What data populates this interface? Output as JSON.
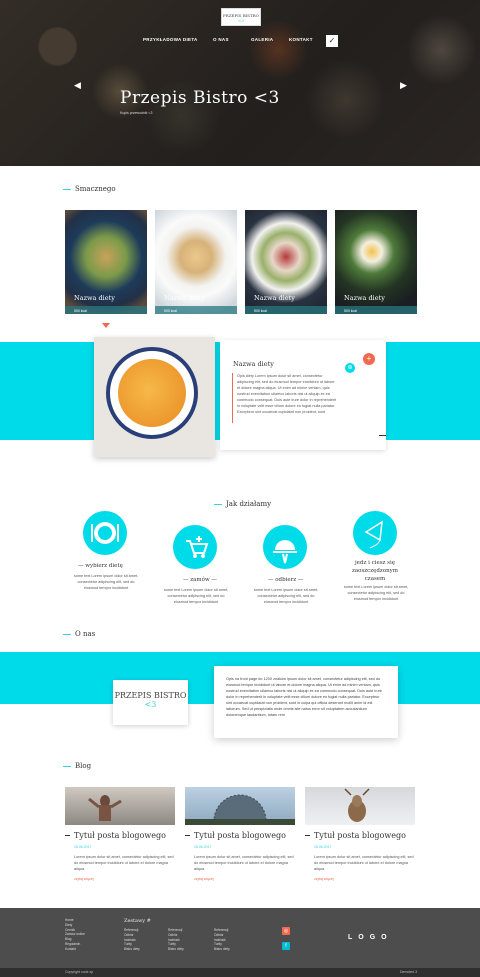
{
  "header": {
    "logo_line1": "PRZEPIS BISTRO",
    "logo_line2": "<3",
    "nav": [
      "PRZYKŁADOWA DIETA",
      "O NAS",
      "GALERIA",
      "KONTAKT"
    ],
    "title": "Przepis Bistro <3",
    "subtitle": "Kupis przewodnik <3"
  },
  "diets": {
    "heading": "Smacznego",
    "cards": [
      {
        "title": "Nazwa diety",
        "kcal": "500 kcal"
      },
      {
        "title": "Nazwa diety",
        "kcal": "500 kcal"
      },
      {
        "title": "Nazwa diety",
        "kcal": "500 kcal"
      },
      {
        "title": "Nazwa diety",
        "kcal": "500 kcal"
      }
    ]
  },
  "featured": {
    "title": "Nazwa diety",
    "text": "Opis diety Lorem ipsum dolor sit amet, consectetur adipiscing elit, sed do eiusmod tempor incididunt ut labore et dolore magna aliqua. Ut enim ad minim veniam, quis nostrud exercitation ullamco laboris nisi ut aliquip ex ea commodo consequat. Duis aute irure dolor in reprehenderit in voluptate velit esse cillum dolore eu fugiat nulla pariatur. Excepteur sint occaecat cupidatat non proident, sunt"
  },
  "how": {
    "heading": "Jak działamy",
    "steps": [
      {
        "label": "wybierz dietę",
        "text": "some text Lorem ipsum dolor sit amet, consectetur adipiscing elit, sed do eiusmod tempor incididunt"
      },
      {
        "label": "zamów",
        "text": "some text Lorem ipsum dolor sit amet, consectetur adipiscing elit, sed do eiusmod tempor incididunt"
      },
      {
        "label": "odbierz",
        "text": "some text Lorem ipsum dolor sit amet, consectetur adipiscing elit, sed do eiusmod tempor incididunt"
      },
      {
        "label": "jedz i ciesz się zaoszczędzonym czasem",
        "text": "some text Lorem ipsum dolor sit amet, consectetur adipiscing elit, sed do eiusmod tempor incididunt"
      }
    ]
  },
  "about": {
    "heading": "O nas",
    "logo_line1": "PRZEPIS BISTRO",
    "logo_line2": "<3",
    "text": "Opis na front page do 1200 znaków ipsum dolor sit amet, consectetur adipiscing elit, sed do eiusmod tempor incididunt ut labore et dolore magna aliqua. Ut enim ad minim veniam, quis nostrud exercitation ullamco laboris nisi ut aliquip ex ea commodo consequat. Duis aute irure dolor in reprehenderit in voluptate velit esse cillum dolore eu fugiat nulla pariatur. Excepteur sint occaecat cupidatat non proident, sunt in culpa qui officia deserunt mollit anim id est laborum. Sed ut perspiciatis unde omnis iste natus error sit voluptatem accusantium doloremque laudantium, totam rem"
  },
  "blog": {
    "heading": "Blog",
    "posts": [
      {
        "title": "Tytuł posta blogowego",
        "date": "26.06.2017",
        "text": "Lorem ipsum dolor sit amet, consectetur adipiscing elit, sed do eiusmod tempor incididunt ut labore et dolore magna aliqua.",
        "more": "czytaj więcej"
      },
      {
        "title": "Tytuł posta blogowego",
        "date": "26.06.2017",
        "text": "Lorem ipsum dolor sit amet, consectetur adipiscing elit, sed do eiusmod tempor incididunt ut labore et dolore magna aliqua.",
        "more": "czytaj więcej"
      },
      {
        "title": "Tytuł posta blogowego",
        "date": "26.06.2017",
        "text": "Lorem ipsum dolor sit amet, consectetur adipiscing elit, sed do eiusmod tempor incididunt ut labore et dolore magna aliqua.",
        "more": "czytaj więcej"
      }
    ]
  },
  "footer": {
    "links": [
      "Home",
      "Diety",
      "Cennik",
      "Zamów online",
      "Blog",
      "Regulamin",
      "Kontakt"
    ],
    "heading": "Zestawy #",
    "col1": [
      "Referencji",
      "Odbiór",
      "Indeksik",
      "Turity",
      "Bistro diety"
    ],
    "col2": [
      "Referencji",
      "Odbiór",
      "Indeksik",
      "Turity",
      "Bistro diety"
    ],
    "col3": [
      "Referencji",
      "Odbiór",
      "Indeksik",
      "Turity",
      "Bistro diety"
    ],
    "logo": "LOGO",
    "copyright": "Copyright cook xp",
    "credit": "Demoted 3"
  },
  "colors": {
    "accent": "#00dbea",
    "highlight": "#f06a4f",
    "footer": "#4d4d4d"
  }
}
